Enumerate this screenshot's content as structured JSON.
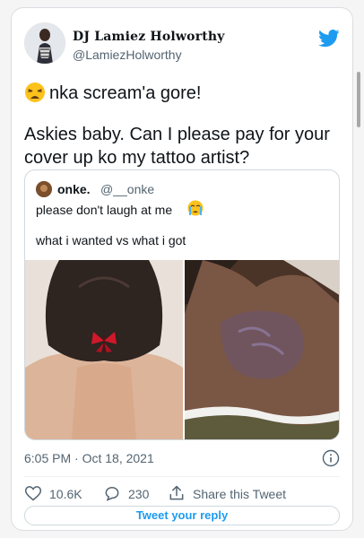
{
  "tweet": {
    "author_name": "DJ Lamiez Holworthy",
    "author_handle": "@LamiezHolworthy",
    "text_line1": "nka scream'a gore!",
    "text_line2": "Askies baby. Can I please pay for your",
    "text_line3": "cover up ko my tattoo artist?",
    "timestamp": "6:05 PM · Oct 18, 2021",
    "likes": "10.6K",
    "replies": "230",
    "share_label": "Share this Tweet",
    "reply_button": "Tweet your reply"
  },
  "quoted": {
    "author_name": "onke.",
    "author_handle": "@__onke",
    "line1": "please don't laugh at me",
    "line2": "what i wanted vs what i got"
  },
  "colors": {
    "twitter_blue": "#1d9bf0",
    "secondary_text": "#536471",
    "border": "#cfd9de"
  },
  "icons": [
    "twitter-bird-icon",
    "weary-face-emoji",
    "crying-face-emoji",
    "info-icon",
    "heart-icon",
    "reply-icon",
    "share-icon"
  ]
}
